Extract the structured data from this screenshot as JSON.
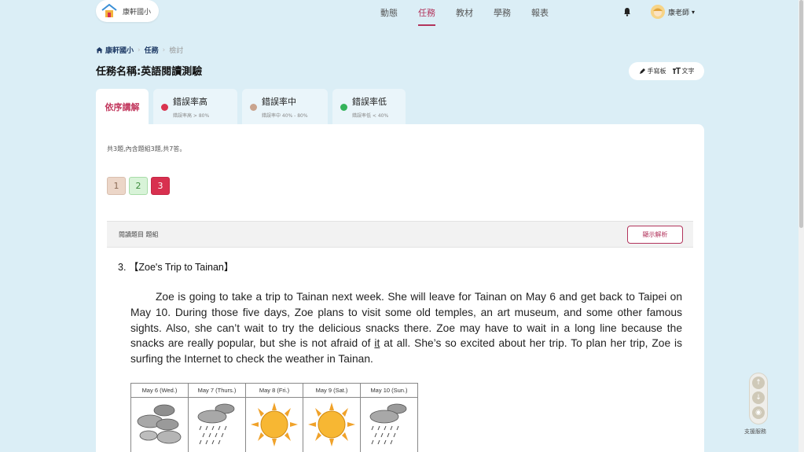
{
  "brand": {
    "name": "康軒國小"
  },
  "nav": {
    "items": [
      {
        "label": "動態"
      },
      {
        "label": "任務"
      },
      {
        "label": "教材"
      },
      {
        "label": "學務"
      },
      {
        "label": "報表"
      }
    ],
    "active_index": 1
  },
  "user": {
    "name": "康老師"
  },
  "breadcrumb": {
    "home": "康軒國小",
    "task": "任務",
    "current": "檢討"
  },
  "page": {
    "title": "任務名稱:英語閱讀測驗"
  },
  "mode_toggle": {
    "handwriting": "手寫板",
    "text": "文字"
  },
  "tabs": {
    "first": "依序講解",
    "rates": [
      {
        "label": "錯誤率高",
        "sub": "錯誤率高 > 80%",
        "color": "#d9344f"
      },
      {
        "label": "錯誤率中",
        "sub": "錯誤率中 40% - 80%",
        "color": "#c9a48e"
      },
      {
        "label": "錯誤率低",
        "sub": "錯誤率低 < 40%",
        "color": "#34b35a"
      }
    ]
  },
  "summary": "共3題,內含題組3題,共7答。",
  "question_numbers": [
    "1",
    "2",
    "3"
  ],
  "question_header": {
    "label": "閱讀題目 題組",
    "explain_button": "顯示解析"
  },
  "question": {
    "title": "3. 【Zoe's Trip to Tainan】",
    "passage_before": "Zoe is going to take a trip to Tainan next week. She will leave for Tainan on May 6 and get back to Taipei on May 10. During those five days, Zoe plans to visit some old temples, an art museum, and some other famous sights. Also, she can’t wait to try the delicious snacks there. Zoe may have to wait in a long line because the snacks are really popular, but she is not afraid of ",
    "passage_underlined": "it",
    "passage_after": " at all. She’s so excited about her trip. To plan her trip, Zoe is surfing the Internet to check the weather in Tainan.",
    "weather": [
      {
        "day": "May 6 (Wed.)",
        "icon": "cloud-icon"
      },
      {
        "day": "May 7 (Thurs.)",
        "icon": "rain-icon"
      },
      {
        "day": "May 8 (Fri.)",
        "icon": "sun-icon"
      },
      {
        "day": "May 9 (Sat.)",
        "icon": "sun-icon"
      },
      {
        "day": "May 10 (Sun.)",
        "icon": "rain-icon"
      }
    ]
  },
  "support": {
    "label": "支援服務"
  },
  "colors": {
    "accent": "#b2345c",
    "background": "#dbeef6"
  }
}
